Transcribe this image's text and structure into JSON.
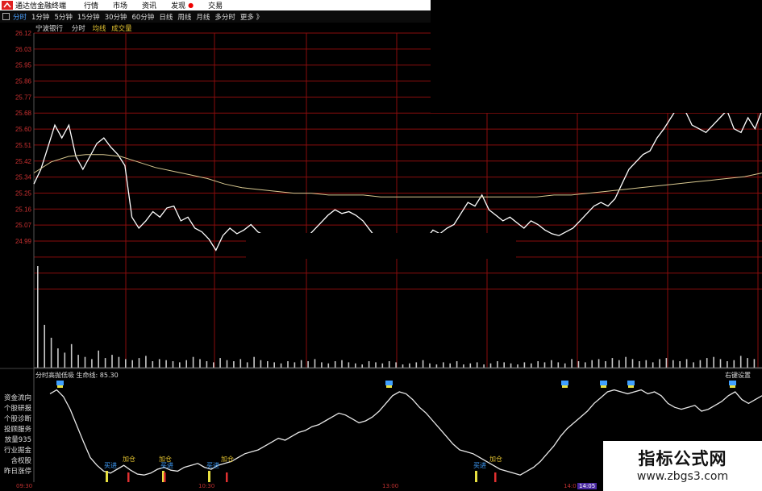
{
  "menubar": {
    "app_name": "通达信金融终端",
    "items": [
      {
        "label": "行情"
      },
      {
        "label": "市场"
      },
      {
        "label": "资讯"
      },
      {
        "label": "发现"
      },
      {
        "label": "交易"
      }
    ],
    "marker": "●"
  },
  "tabs": [
    {
      "label": "分时",
      "active": true
    },
    {
      "label": "1分钟"
    },
    {
      "label": "5分钟"
    },
    {
      "label": "15分钟"
    },
    {
      "label": "30分钟"
    },
    {
      "label": "60分钟"
    },
    {
      "label": "日线"
    },
    {
      "label": "周线"
    },
    {
      "label": "月线"
    },
    {
      "label": "多分时"
    },
    {
      "label": "更多 》"
    }
  ],
  "chart_title": {
    "stock": "宁波银行",
    "mode": "分时",
    "avg_label": "均线",
    "volume_label": "成交量"
  },
  "indicator": {
    "name": "分时高抛低吸",
    "life_line_label": "生命线:",
    "life_line_value": "85.30",
    "right_settings": "右键设置",
    "signal_buy": "买进",
    "signal_add": "加仓"
  },
  "side_menu": [
    "资金流向",
    "个股研报",
    "个股诊断",
    "投顾服务",
    "放量935",
    "行业掘金",
    "含权股",
    "昨日涨停"
  ],
  "time_axis": {
    "labels": [
      "09:30",
      "10:30",
      "13:00",
      "14:0",
      "14:05"
    ]
  },
  "watermark": {
    "title": "指标公式网",
    "url": "www.zbgs3.com"
  },
  "colors": {
    "grid": "#8a0d0d",
    "price_line": "#ffffff",
    "avg_line": "#d8c890",
    "volume": "#c8c8c8",
    "axis_text": "#c83030",
    "buy_signal": "#40a0ff",
    "add_signal": "#e0c030"
  },
  "chart_data": [
    {
      "type": "line",
      "y_ticks": [
        "26.12",
        "26.03",
        "25.95",
        "25.86",
        "25.77",
        "25.68",
        "25.60",
        "25.51",
        "25.42",
        "25.34",
        "25.25",
        "25.16",
        "25.07",
        "24.99"
      ],
      "ylim": [
        24.99,
        26.12
      ],
      "series": [
        {
          "name": "分时",
          "values": [
            25.3,
            25.38,
            25.5,
            25.62,
            25.55,
            25.62,
            25.45,
            25.38,
            25.45,
            25.52,
            25.55,
            25.5,
            25.46,
            25.4,
            25.12,
            25.06,
            25.1,
            25.15,
            25.12,
            25.17,
            25.18,
            25.1,
            25.12,
            25.06,
            25.04,
            25.0,
            24.94,
            25.02,
            25.06,
            25.03,
            25.05,
            25.08,
            25.04,
            25.02,
            25.03,
            24.98,
            24.94,
            24.92,
            24.96,
            25.01,
            25.05,
            25.09,
            25.13,
            25.16,
            25.14,
            25.15,
            25.13,
            25.1,
            25.05,
            25.0,
            24.96,
            24.95,
            25.0,
            25.02,
            24.98,
            24.97,
            25.0,
            25.05,
            25.03,
            25.06,
            25.08,
            25.14,
            25.2,
            25.18,
            25.24,
            25.16,
            25.13,
            25.1,
            25.12,
            25.09,
            25.06,
            25.1,
            25.08,
            25.05,
            25.03,
            25.02,
            25.04,
            25.06,
            25.1,
            25.14,
            25.18,
            25.2,
            25.18,
            25.22,
            25.3,
            25.38,
            25.42,
            25.46,
            25.48,
            25.55,
            25.6,
            25.66,
            25.72,
            25.7,
            25.62,
            25.6,
            25.58,
            25.62,
            25.66,
            25.7,
            25.6,
            25.58,
            25.66,
            25.6,
            25.7
          ]
        },
        {
          "name": "均线",
          "values": [
            25.36,
            25.42,
            25.45,
            25.46,
            25.46,
            25.45,
            25.42,
            25.39,
            25.37,
            25.35,
            25.33,
            25.3,
            25.28,
            25.27,
            25.26,
            25.25,
            25.25,
            25.24,
            25.24,
            25.24,
            25.23,
            25.23,
            25.23,
            25.23,
            25.23,
            25.23,
            25.23,
            25.23,
            25.23,
            25.23,
            25.24,
            25.24,
            25.25,
            25.26,
            25.27,
            25.28,
            25.29,
            25.3,
            25.31,
            25.32,
            25.33,
            25.34,
            25.36
          ]
        }
      ]
    },
    {
      "type": "bar",
      "name": "成交量",
      "values": [
        95,
        40,
        28,
        18,
        14,
        22,
        12,
        10,
        8,
        16,
        9,
        12,
        10,
        8,
        7,
        9,
        11,
        6,
        8,
        7,
        6,
        5,
        7,
        10,
        8,
        6,
        5,
        9,
        7,
        6,
        8,
        5,
        10,
        7,
        6,
        5,
        4,
        6,
        5,
        7,
        6,
        8,
        5,
        4,
        6,
        7,
        5,
        4,
        3,
        6,
        5,
        4,
        6,
        5,
        3,
        4,
        5,
        7,
        4,
        3,
        5,
        4,
        6,
        3,
        4,
        5,
        3,
        4,
        6,
        5,
        4,
        3,
        5,
        4,
        6,
        5,
        7,
        5,
        4,
        8,
        6,
        5,
        7,
        8,
        6,
        9,
        7,
        10,
        8,
        6,
        7,
        5,
        8,
        9,
        7,
        6,
        8,
        5,
        7,
        9,
        10,
        8,
        6,
        7,
        11,
        9,
        8
      ]
    },
    {
      "type": "line",
      "name": "分时高抛低吸",
      "ylim": [
        0,
        100
      ],
      "values": [
        88,
        92,
        85,
        72,
        55,
        38,
        22,
        14,
        8,
        6,
        10,
        14,
        9,
        5,
        4,
        6,
        10,
        12,
        9,
        8,
        12,
        14,
        16,
        12,
        10,
        14,
        16,
        18,
        22,
        26,
        28,
        30,
        34,
        38,
        42,
        40,
        44,
        48,
        50,
        54,
        56,
        60,
        64,
        68,
        66,
        62,
        58,
        60,
        64,
        70,
        78,
        86,
        90,
        88,
        82,
        74,
        68,
        60,
        52,
        44,
        36,
        30,
        28,
        26,
        22,
        18,
        14,
        10,
        8,
        6,
        4,
        8,
        12,
        18,
        26,
        34,
        44,
        52,
        58,
        64,
        70,
        78,
        84,
        90,
        92,
        90,
        88,
        90,
        92,
        88,
        90,
        86,
        78,
        74,
        72,
        74,
        76,
        70,
        72,
        76,
        80,
        86,
        90,
        82,
        78,
        82,
        86
      ]
    }
  ]
}
